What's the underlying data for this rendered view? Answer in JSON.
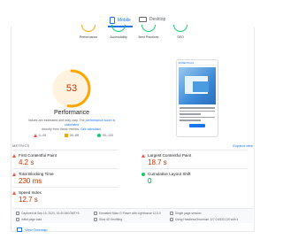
{
  "device_tabs": {
    "mobile": "Mobile",
    "desktop": "Desktop"
  },
  "categories": [
    {
      "label": "Performance",
      "status": "average"
    },
    {
      "label": "Accessibility",
      "status": "good"
    },
    {
      "label": "Best Practices",
      "status": "good"
    },
    {
      "label": "SEO",
      "status": "good"
    }
  ],
  "performance": {
    "score": "53",
    "title": "Performance",
    "note_prefix": "Values are estimated and may vary. The",
    "note_link": "performance score is calculated",
    "note_suffix": "directly from these metrics.",
    "note_link2": "See calculator."
  },
  "legend": {
    "fail": "0–49",
    "average": "50–89",
    "pass": "90–100"
  },
  "screenshot": {
    "site_name": "ESSENTIALS"
  },
  "metrics": {
    "header": "METRICS",
    "expand": "Expand view",
    "fcp": {
      "name": "First Contentful Paint",
      "value": "4.2 s"
    },
    "lcp": {
      "name": "Largest Contentful Paint",
      "value": "18.7 s"
    },
    "tbt": {
      "name": "Total Blocking Time",
      "value": "230 ms"
    },
    "cls": {
      "name": "Cumulative Layout Shift",
      "value": "0"
    },
    "si": {
      "name": "Speed Index",
      "value": "12.7 s"
    }
  },
  "info": {
    "captured": "Captured at Sep 16, 2024, 10:40 AM GMT+5",
    "initial_load": "Initial page load",
    "emulated": "Emulated Moto G Power with Lighthouse 12.0.0",
    "throttling": "Slow 4G throttling",
    "session": "Single page session",
    "browser": "Using HeadlessChromium 127.0.6533.119 with lr"
  },
  "treemap": "View Treemap",
  "colors": {
    "fail": "#ff4e42",
    "average": "#ffa400",
    "pass": "#0cce6b",
    "accent": "#1a73e8"
  }
}
